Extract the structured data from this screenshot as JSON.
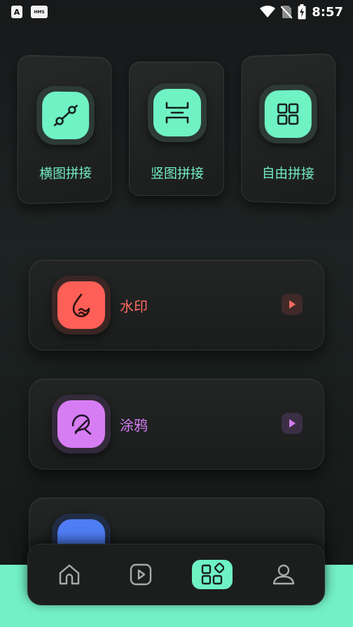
{
  "status_bar": {
    "time": "8:57",
    "left_badges": [
      "A",
      "HMS"
    ],
    "icons": [
      "wifi-icon",
      "no-sim-icon",
      "battery-charging-icon"
    ]
  },
  "tools": [
    {
      "label": "横图拼接",
      "icon": "horizontal-stitch-icon"
    },
    {
      "label": "竖图拼接",
      "icon": "vertical-stitch-icon"
    },
    {
      "label": "自由拼接",
      "icon": "grid-stitch-icon"
    }
  ],
  "features": [
    {
      "label": "水印",
      "icon": "watermark-icon",
      "color": "#ff5f57",
      "ring": "#3b2624",
      "play_bg": "#3f2a29",
      "play_color": "#ff6a60"
    },
    {
      "label": "涂鸦",
      "icon": "doodle-icon",
      "color": "#d77df4",
      "ring": "#332a3b",
      "play_bg": "#3b2f45",
      "play_color": "#d77df4"
    },
    {
      "label": "",
      "icon": "partial-icon",
      "color": "#4f7df5",
      "ring": "#202c44"
    }
  ],
  "nav": [
    {
      "name": "home",
      "icon": "home-icon"
    },
    {
      "name": "video",
      "icon": "play-square-icon"
    },
    {
      "name": "tools",
      "icon": "apps-grid-icon",
      "active": true
    },
    {
      "name": "profile",
      "icon": "user-icon"
    }
  ],
  "colors": {
    "accent": "#6ff2c4",
    "background": "#17191a"
  }
}
